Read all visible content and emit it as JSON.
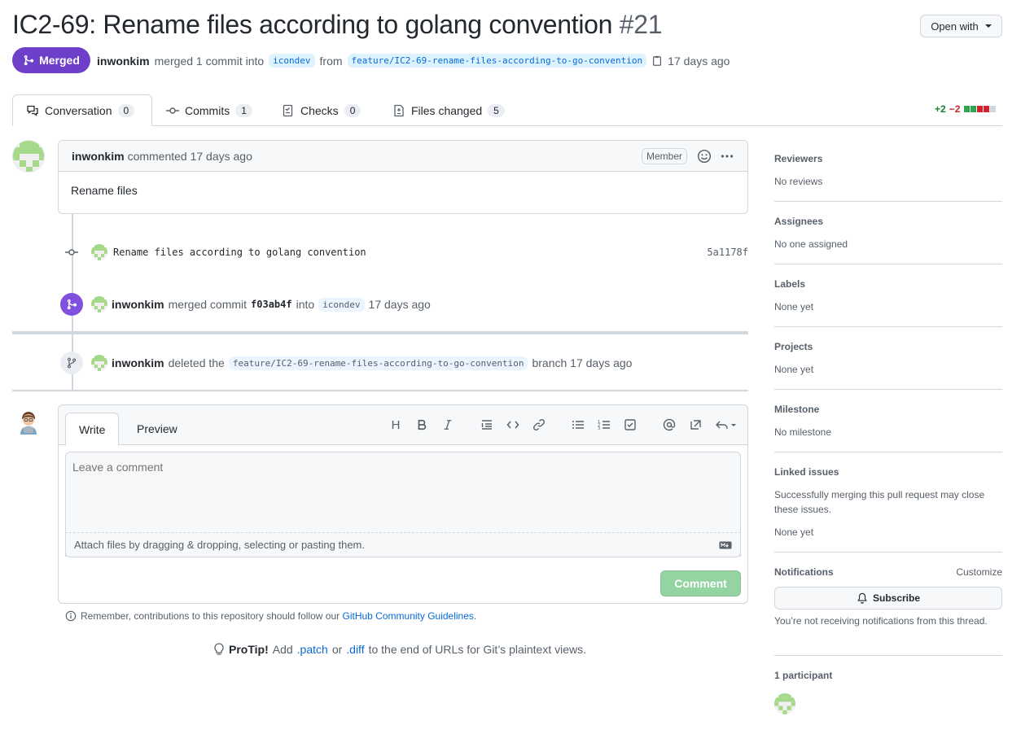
{
  "pr": {
    "title": "IC2-69: Rename files according to golang convention",
    "number": "#21",
    "open_with": "Open with",
    "state": "Merged",
    "author": "inwonkim",
    "merge_text": "merged 1 commit into",
    "base_branch": "icondev",
    "from": "from",
    "head_branch": "feature/IC2-69-rename-files-according-to-go-convention",
    "time": "17 days ago"
  },
  "tabs": [
    {
      "label": "Conversation",
      "count": "0"
    },
    {
      "label": "Commits",
      "count": "1"
    },
    {
      "label": "Checks",
      "count": "0"
    },
    {
      "label": "Files changed",
      "count": "5"
    }
  ],
  "diffstat": {
    "additions": "+2",
    "deletions": "−2",
    "colors": [
      "#2da44e",
      "#2da44e",
      "#cf222e",
      "#cf222e",
      "#d0d7de"
    ]
  },
  "comment": {
    "author": "inwonkim",
    "action": "commented 17 days ago",
    "badge": "Member",
    "body": "Rename files"
  },
  "commit": {
    "message": "Rename files according to golang convention",
    "sha": "5a1178f"
  },
  "merge_event": {
    "author": "inwonkim",
    "text1": "merged commit",
    "sha": "f03ab4f",
    "text2": "into",
    "branch": "icondev",
    "time": "17 days ago"
  },
  "delete_event": {
    "author": "inwonkim",
    "text1": "deleted the",
    "branch": "feature/IC2-69-rename-files-according-to-go-convention",
    "text2": "branch 17 days ago"
  },
  "editor": {
    "write_tab": "Write",
    "preview_tab": "Preview",
    "placeholder": "Leave a comment",
    "attach": "Attach files by dragging & dropping, selecting or pasting them.",
    "submit": "Comment",
    "toolbar_heading": "H"
  },
  "footer": {
    "remember": "Remember, contributions to this repository should follow our",
    "guidelines_link": "GitHub Community Guidelines",
    "period": ".",
    "protip_label": "ProTip!",
    "protip_1": "Add",
    "patch": ".patch",
    "or": "or",
    "diff": ".diff",
    "protip_2": "to the end of URLs for Git’s plaintext views."
  },
  "sidebar": {
    "reviewers": {
      "title": "Reviewers",
      "value": "No reviews"
    },
    "assignees": {
      "title": "Assignees",
      "value": "No one assigned"
    },
    "labels": {
      "title": "Labels",
      "value": "None yet"
    },
    "projects": {
      "title": "Projects",
      "value": "None yet"
    },
    "milestone": {
      "title": "Milestone",
      "value": "No milestone"
    },
    "linked": {
      "title": "Linked issues",
      "desc": "Successfully merging this pull request may close these issues.",
      "value": "None yet"
    },
    "notifications": {
      "title": "Notifications",
      "customize": "Customize",
      "subscribe": "Subscribe",
      "desc": "You’re not receiving notifications from this thread."
    },
    "participants": {
      "title": "1 participant"
    }
  }
}
